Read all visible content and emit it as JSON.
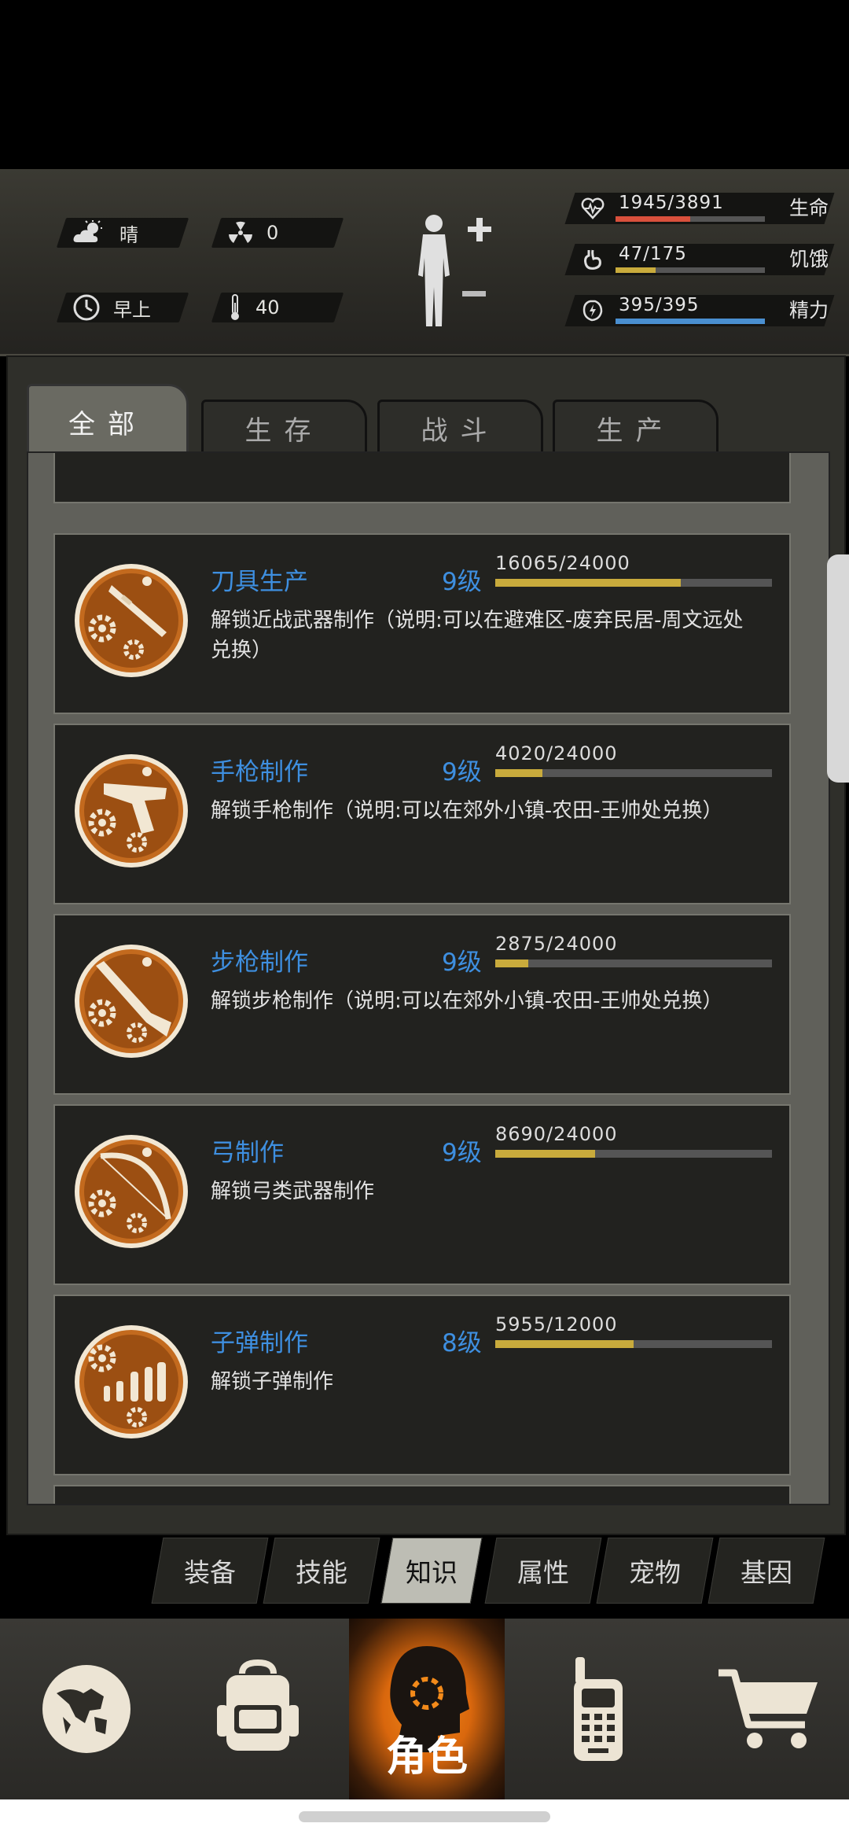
{
  "hud": {
    "weather": {
      "label": "晴",
      "icon": "sun-cloud-icon"
    },
    "radiation": {
      "value": "0",
      "icon": "radiation-icon"
    },
    "time": {
      "label": "早上",
      "icon": "clock-icon"
    },
    "temperature": {
      "value": "40",
      "icon": "thermometer-icon"
    },
    "stats": [
      {
        "label": "生命",
        "value": "1945/3891",
        "fraction": 0.5,
        "color": "#d9503c",
        "icon": "heart-icon"
      },
      {
        "label": "饥饿",
        "value": "47/175",
        "fraction": 0.27,
        "color": "#c9ab3c",
        "icon": "stomach-icon"
      },
      {
        "label": "精力",
        "value": "395/395",
        "fraction": 1.0,
        "color": "#4a8fd0",
        "icon": "energy-icon"
      }
    ]
  },
  "tabs": [
    {
      "label": "全部",
      "active": true
    },
    {
      "label": "生存",
      "active": false
    },
    {
      "label": "战斗",
      "active": false
    },
    {
      "label": "生产",
      "active": false
    }
  ],
  "skills": [
    {
      "title": "刀具生产",
      "level": "9级",
      "progress_text": "16065/24000",
      "fraction": 0.67,
      "desc": "解锁近战武器制作（说明:可以在避难区-废弃民居-周文远处兑换）",
      "icon": "knife-gear-medal-icon"
    },
    {
      "title": "手枪制作",
      "level": "9级",
      "progress_text": "4020/24000",
      "fraction": 0.17,
      "desc": "解锁手枪制作（说明:可以在郊外小镇-农田-王帅处兑换）",
      "icon": "pistol-gear-medal-icon"
    },
    {
      "title": "步枪制作",
      "level": "9级",
      "progress_text": "2875/24000",
      "fraction": 0.12,
      "desc": "解锁步枪制作（说明:可以在郊外小镇-农田-王帅处兑换）",
      "icon": "rifle-gear-medal-icon"
    },
    {
      "title": "弓制作",
      "level": "9级",
      "progress_text": "8690/24000",
      "fraction": 0.36,
      "desc": "解锁弓类武器制作",
      "icon": "bow-gear-medal-icon"
    },
    {
      "title": "子弹制作",
      "level": "8级",
      "progress_text": "5955/12000",
      "fraction": 0.5,
      "desc": "解锁子弹制作",
      "icon": "bullets-gear-medal-icon"
    }
  ],
  "subnav": [
    {
      "label": "装备",
      "active": false
    },
    {
      "label": "技能",
      "active": false
    },
    {
      "label": "知识",
      "active": true
    },
    {
      "label": "属性",
      "active": false
    },
    {
      "label": "宠物",
      "active": false
    },
    {
      "label": "基因",
      "active": false
    }
  ],
  "bottom_nav": [
    {
      "icon": "globe-icon"
    },
    {
      "icon": "backpack-icon"
    },
    {
      "icon": "character-head-icon",
      "label": "角色",
      "active": true
    },
    {
      "icon": "walkie-talkie-icon"
    },
    {
      "icon": "shopping-cart-icon"
    }
  ]
}
